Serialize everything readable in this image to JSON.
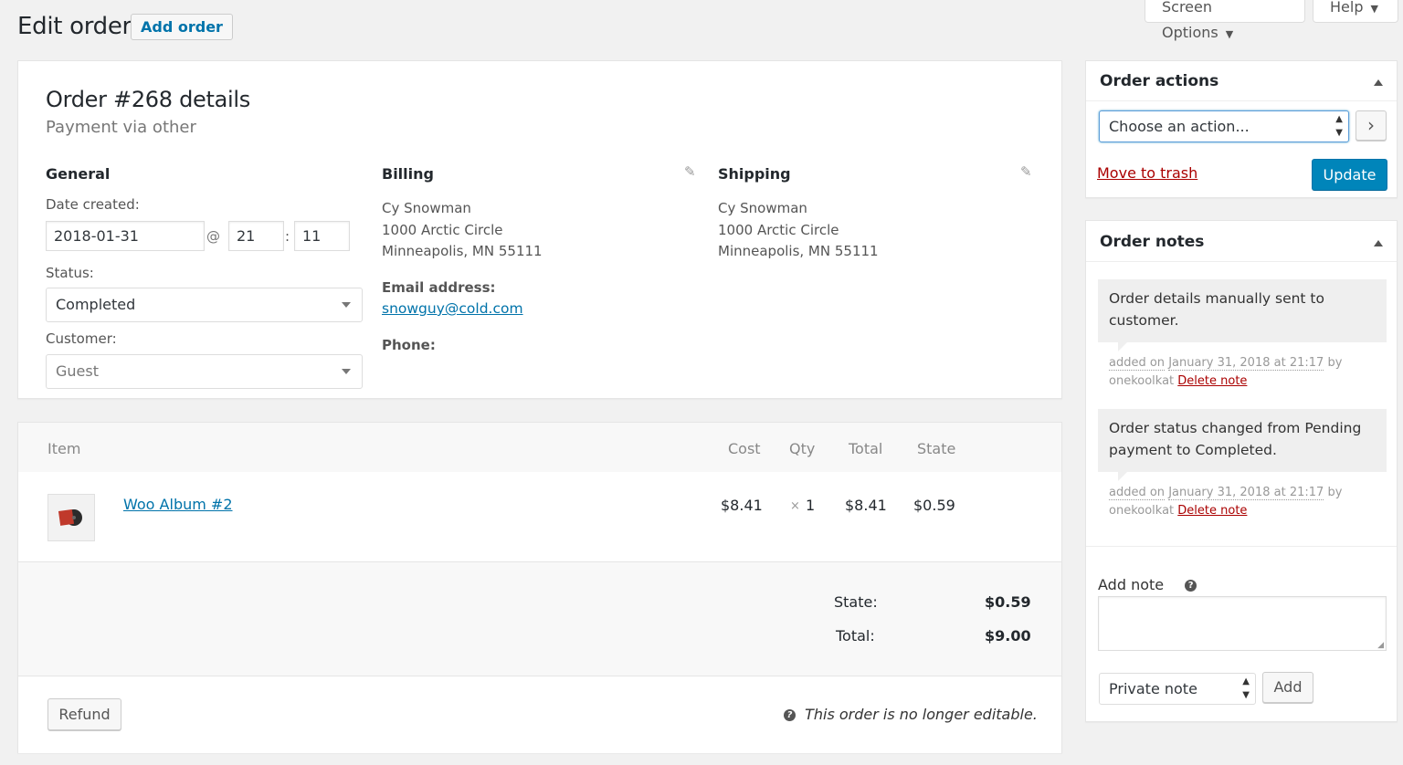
{
  "header": {
    "title": "Edit order",
    "add_order_label": "Add order",
    "screen_options_label": "Screen Options",
    "help_label": "Help"
  },
  "order": {
    "title": "Order #268 details",
    "subtitle": "Payment via other",
    "general": {
      "heading": "General",
      "date_label": "Date created:",
      "date_value": "2018-01-31",
      "at": "@",
      "hour": "21",
      "colon": ":",
      "minute": "11",
      "status_label": "Status:",
      "status_value": "Completed",
      "customer_label": "Customer:",
      "customer_value": "Guest"
    },
    "billing": {
      "heading": "Billing",
      "name": "Cy Snowman",
      "address1": "1000 Arctic Circle",
      "city": "Minneapolis, MN 55111",
      "email_label": "Email address:",
      "email": "snowguy@cold.com",
      "phone_label": "Phone:"
    },
    "shipping": {
      "heading": "Shipping",
      "name": "Cy Snowman",
      "address1": "1000 Arctic Circle",
      "city": "Minneapolis, MN 55111"
    }
  },
  "items": {
    "headers": {
      "item": "Item",
      "cost": "Cost",
      "qty": "Qty",
      "total": "Total",
      "state": "State"
    },
    "rows": [
      {
        "name": "Woo Album #2",
        "cost": "$8.41",
        "qty_prefix": "×",
        "qty": "1",
        "total": "$8.41",
        "state": "$0.59"
      }
    ],
    "totals": {
      "state_label": "State:",
      "state_value": "$0.59",
      "total_label": "Total:",
      "total_value": "$9.00"
    },
    "refund_label": "Refund",
    "not_editable": "This order is no longer editable."
  },
  "order_actions": {
    "heading": "Order actions",
    "select_value": "Choose an action...",
    "go_label": "›",
    "trash_label": "Move to trash",
    "update_label": "Update"
  },
  "order_notes": {
    "heading": "Order notes",
    "notes": [
      {
        "text": "Order details manually sent to customer.",
        "added_prefix": "added on",
        "date": "January 31, 2018 at 21:17",
        "by": "by",
        "author": "onekoolkat",
        "delete_label": "Delete note"
      },
      {
        "text": "Order status changed from Pending payment to Completed.",
        "added_prefix": "added on",
        "date": "January 31, 2018 at 21:17",
        "by": "by",
        "author": "onekoolkat",
        "delete_label": "Delete note"
      }
    ],
    "add_note_label": "Add note",
    "note_type_value": "Private note",
    "add_button_label": "Add"
  },
  "colors": {
    "primary": "#0085ba",
    "link": "#0073aa",
    "danger": "#a00"
  }
}
